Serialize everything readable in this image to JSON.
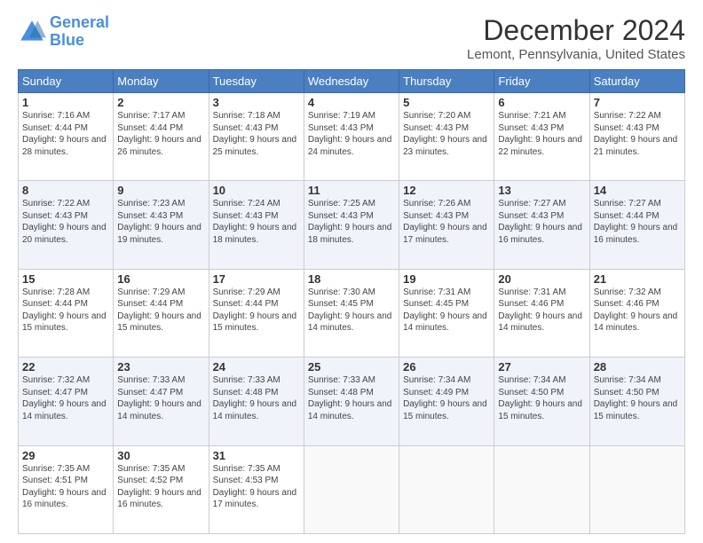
{
  "header": {
    "logo_line1": "General",
    "logo_line2": "Blue",
    "title": "December 2024",
    "subtitle": "Lemont, Pennsylvania, United States"
  },
  "days_of_week": [
    "Sunday",
    "Monday",
    "Tuesday",
    "Wednesday",
    "Thursday",
    "Friday",
    "Saturday"
  ],
  "weeks": [
    [
      {
        "day": "1",
        "sunrise": "7:16 AM",
        "sunset": "4:44 PM",
        "daylight": "9 hours and 28 minutes."
      },
      {
        "day": "2",
        "sunrise": "7:17 AM",
        "sunset": "4:44 PM",
        "daylight": "9 hours and 26 minutes."
      },
      {
        "day": "3",
        "sunrise": "7:18 AM",
        "sunset": "4:43 PM",
        "daylight": "9 hours and 25 minutes."
      },
      {
        "day": "4",
        "sunrise": "7:19 AM",
        "sunset": "4:43 PM",
        "daylight": "9 hours and 24 minutes."
      },
      {
        "day": "5",
        "sunrise": "7:20 AM",
        "sunset": "4:43 PM",
        "daylight": "9 hours and 23 minutes."
      },
      {
        "day": "6",
        "sunrise": "7:21 AM",
        "sunset": "4:43 PM",
        "daylight": "9 hours and 22 minutes."
      },
      {
        "day": "7",
        "sunrise": "7:22 AM",
        "sunset": "4:43 PM",
        "daylight": "9 hours and 21 minutes."
      }
    ],
    [
      {
        "day": "8",
        "sunrise": "7:22 AM",
        "sunset": "4:43 PM",
        "daylight": "9 hours and 20 minutes."
      },
      {
        "day": "9",
        "sunrise": "7:23 AM",
        "sunset": "4:43 PM",
        "daylight": "9 hours and 19 minutes."
      },
      {
        "day": "10",
        "sunrise": "7:24 AM",
        "sunset": "4:43 PM",
        "daylight": "9 hours and 18 minutes."
      },
      {
        "day": "11",
        "sunrise": "7:25 AM",
        "sunset": "4:43 PM",
        "daylight": "9 hours and 18 minutes."
      },
      {
        "day": "12",
        "sunrise": "7:26 AM",
        "sunset": "4:43 PM",
        "daylight": "9 hours and 17 minutes."
      },
      {
        "day": "13",
        "sunrise": "7:27 AM",
        "sunset": "4:43 PM",
        "daylight": "9 hours and 16 minutes."
      },
      {
        "day": "14",
        "sunrise": "7:27 AM",
        "sunset": "4:44 PM",
        "daylight": "9 hours and 16 minutes."
      }
    ],
    [
      {
        "day": "15",
        "sunrise": "7:28 AM",
        "sunset": "4:44 PM",
        "daylight": "9 hours and 15 minutes."
      },
      {
        "day": "16",
        "sunrise": "7:29 AM",
        "sunset": "4:44 PM",
        "daylight": "9 hours and 15 minutes."
      },
      {
        "day": "17",
        "sunrise": "7:29 AM",
        "sunset": "4:44 PM",
        "daylight": "9 hours and 15 minutes."
      },
      {
        "day": "18",
        "sunrise": "7:30 AM",
        "sunset": "4:45 PM",
        "daylight": "9 hours and 14 minutes."
      },
      {
        "day": "19",
        "sunrise": "7:31 AM",
        "sunset": "4:45 PM",
        "daylight": "9 hours and 14 minutes."
      },
      {
        "day": "20",
        "sunrise": "7:31 AM",
        "sunset": "4:46 PM",
        "daylight": "9 hours and 14 minutes."
      },
      {
        "day": "21",
        "sunrise": "7:32 AM",
        "sunset": "4:46 PM",
        "daylight": "9 hours and 14 minutes."
      }
    ],
    [
      {
        "day": "22",
        "sunrise": "7:32 AM",
        "sunset": "4:47 PM",
        "daylight": "9 hours and 14 minutes."
      },
      {
        "day": "23",
        "sunrise": "7:33 AM",
        "sunset": "4:47 PM",
        "daylight": "9 hours and 14 minutes."
      },
      {
        "day": "24",
        "sunrise": "7:33 AM",
        "sunset": "4:48 PM",
        "daylight": "9 hours and 14 minutes."
      },
      {
        "day": "25",
        "sunrise": "7:33 AM",
        "sunset": "4:48 PM",
        "daylight": "9 hours and 14 minutes."
      },
      {
        "day": "26",
        "sunrise": "7:34 AM",
        "sunset": "4:49 PM",
        "daylight": "9 hours and 15 minutes."
      },
      {
        "day": "27",
        "sunrise": "7:34 AM",
        "sunset": "4:50 PM",
        "daylight": "9 hours and 15 minutes."
      },
      {
        "day": "28",
        "sunrise": "7:34 AM",
        "sunset": "4:50 PM",
        "daylight": "9 hours and 15 minutes."
      }
    ],
    [
      {
        "day": "29",
        "sunrise": "7:35 AM",
        "sunset": "4:51 PM",
        "daylight": "9 hours and 16 minutes."
      },
      {
        "day": "30",
        "sunrise": "7:35 AM",
        "sunset": "4:52 PM",
        "daylight": "9 hours and 16 minutes."
      },
      {
        "day": "31",
        "sunrise": "7:35 AM",
        "sunset": "4:53 PM",
        "daylight": "9 hours and 17 minutes."
      },
      null,
      null,
      null,
      null
    ]
  ]
}
